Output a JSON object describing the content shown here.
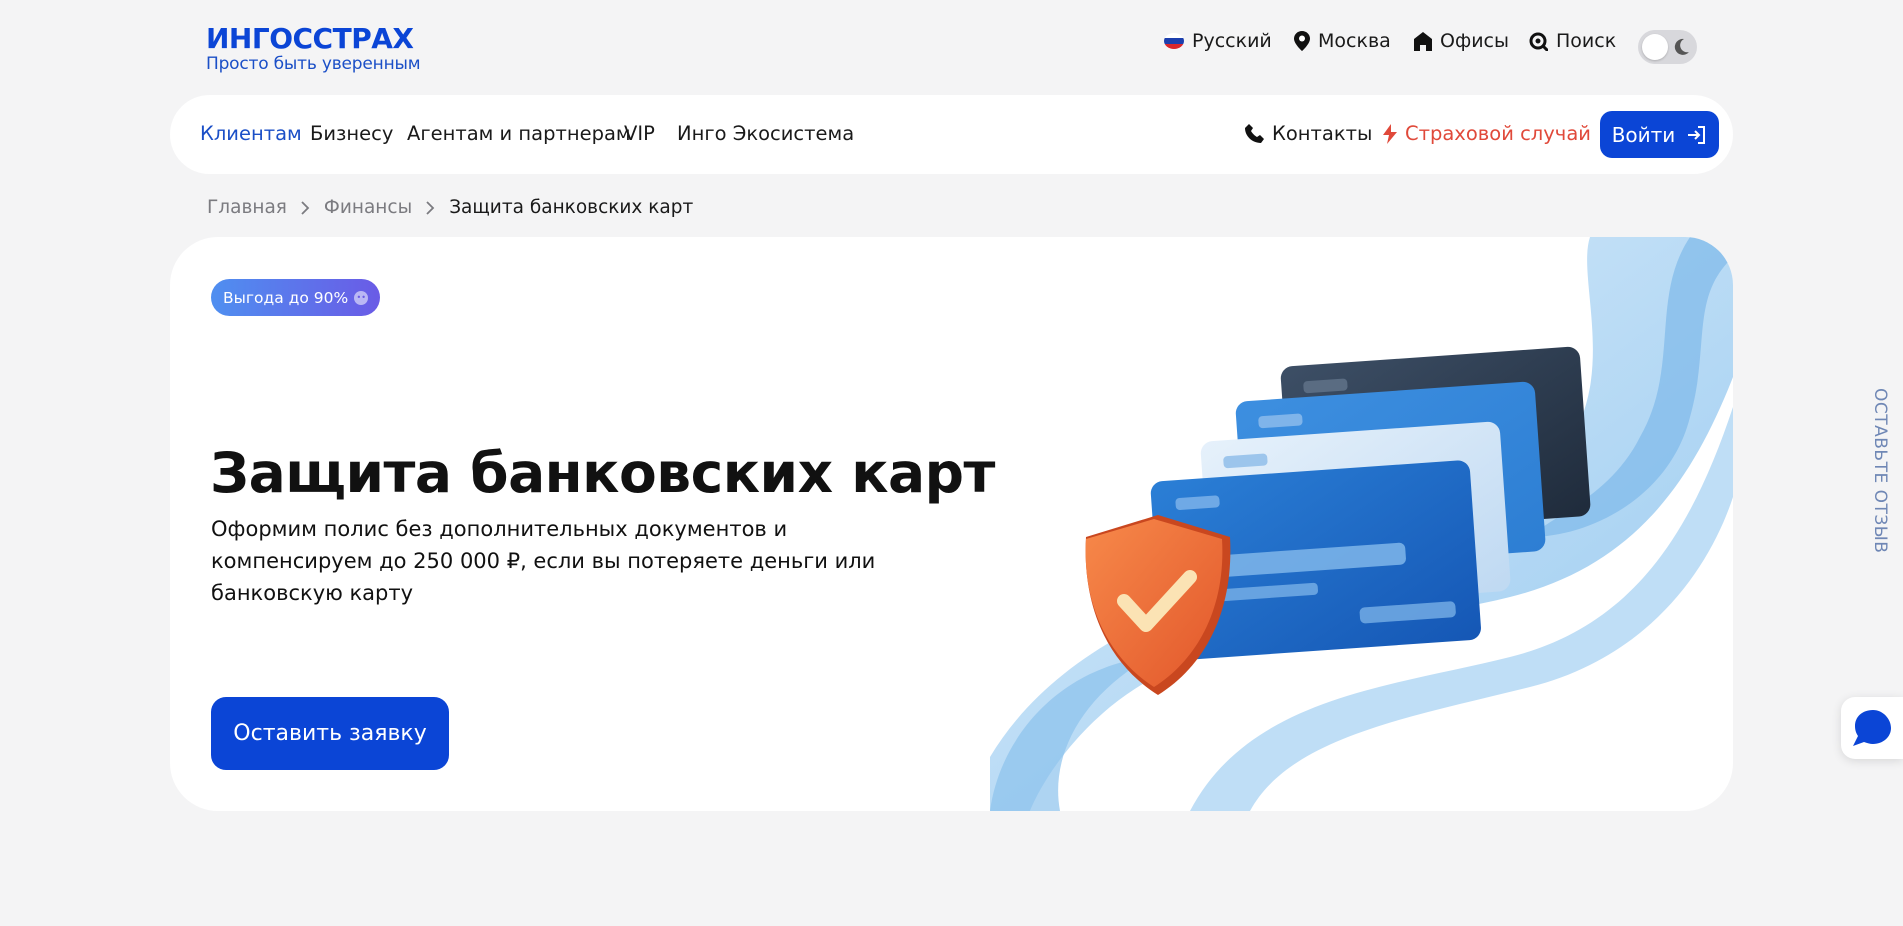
{
  "brand": {
    "name": "ИНГОССТРАХ",
    "tagline": "Просто быть уверенным",
    "accent": "#0b45d6",
    "claim_color": "#e0493a"
  },
  "utility": {
    "language": "Русский",
    "city": "Москва",
    "offices": "Офисы",
    "search": "Поиск",
    "theme_toggle_icon": "moon-icon"
  },
  "nav": {
    "items": [
      "Клиентам",
      "Бизнесу",
      "Агентам и партнерам",
      "VIP",
      "Инго Экосистема"
    ],
    "active": "Клиентам",
    "contacts": "Контакты",
    "claim": "Страховой случай",
    "login": "Войти"
  },
  "breadcrumb": [
    "Главная",
    "Финансы",
    "Защита банковских карт"
  ],
  "hero": {
    "badge": "Выгода до 90%",
    "title": "Защита банковских карт",
    "description": "Оформим полис без дополнительных документов и компенсируем до 250 000 ₽, если вы потеряете деньги или банковскую карту",
    "cta": "Оставить заявку"
  },
  "side": {
    "feedback": "ОСТАВЬТЕ ОТЗЫВ",
    "chat_icon": "chat-bubble-icon"
  }
}
